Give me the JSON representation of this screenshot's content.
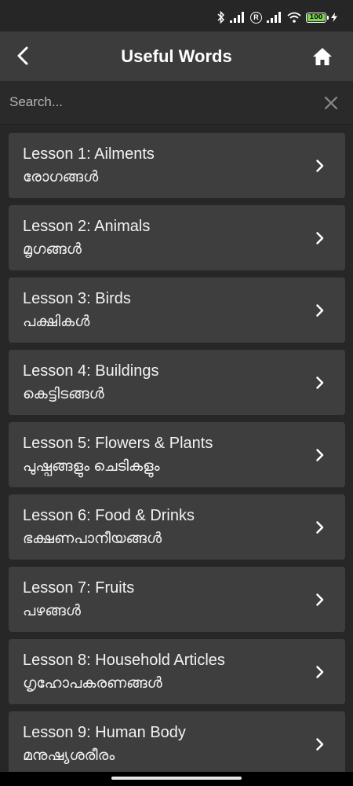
{
  "status_bar": {
    "battery": "100",
    "icons": [
      "bluetooth-icon",
      "signal-icon",
      "roaming-icon",
      "signal-icon",
      "wifi-icon",
      "battery-icon",
      "charging-icon"
    ]
  },
  "app_bar": {
    "title": "Useful Words",
    "back_icon": "back-arrow-icon",
    "home_icon": "home-icon"
  },
  "search": {
    "placeholder": "Search...",
    "clear_icon": "close-icon"
  },
  "lessons": [
    {
      "title": "Lesson 1: Ailments",
      "subtitle": "രോഗങ്ങൾ"
    },
    {
      "title": "Lesson 2: Animals",
      "subtitle": "മൃഗങ്ങൾ"
    },
    {
      "title": "Lesson 3: Birds",
      "subtitle": "പക്ഷികൾ"
    },
    {
      "title": "Lesson 4: Buildings",
      "subtitle": "കെട്ടിടങ്ങൾ"
    },
    {
      "title": "Lesson 5: Flowers & Plants",
      "subtitle": "പുഷ്പങ്ങളും ചെടികളും"
    },
    {
      "title": "Lesson 6: Food & Drinks",
      "subtitle": "ഭക്ഷണപാനീയങ്ങൾ"
    },
    {
      "title": "Lesson 7: Fruits",
      "subtitle": "പഴങ്ങൾ"
    },
    {
      "title": "Lesson 8: Household Articles",
      "subtitle": "ഗൃഹോപകരണങ്ങൾ"
    },
    {
      "title": "Lesson 9: Human Body",
      "subtitle": "മനുഷ്യശരീരം"
    }
  ],
  "colors": {
    "background": "#272727",
    "app_bar": "#3c3c3c",
    "card": "#3e3e3e",
    "battery": "#7CD64C"
  }
}
